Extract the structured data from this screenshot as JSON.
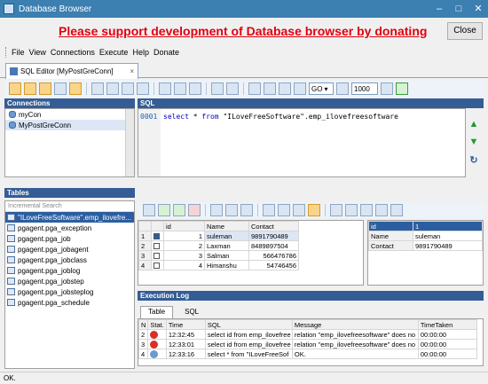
{
  "window": {
    "title": "Database Browser"
  },
  "banner": {
    "text": "Please support development of Database browser by donating",
    "color": "#e1000f"
  },
  "close_button": {
    "label": "Close"
  },
  "menu": [
    "File",
    "View",
    "Connections",
    "Execute",
    "Help",
    "Donate"
  ],
  "editor_tab": {
    "label": "SQL Editor [MyPostGreConn]"
  },
  "toolbar": {
    "go_label": "GO",
    "limit_value": "1000"
  },
  "connections": {
    "header": "Connections",
    "items": [
      {
        "label": "myCon"
      },
      {
        "label": "MyPostGreConn"
      }
    ]
  },
  "sql": {
    "header": "SQL",
    "line_no": "0001",
    "code_kw1": "select",
    "code_mid": " * ",
    "code_kw2": "from",
    "code_rest": " \"ILoveFreeSoftware\".emp_ilovefreesoftware"
  },
  "tables": {
    "header": "Tables",
    "search_placeholder": "Incremental Search",
    "items": [
      "\"ILoveFreeSoftware\".emp_ilovefre...",
      "pgagent.pga_exception",
      "pgagent.pga_job",
      "pgagent.pga_jobagent",
      "pgagent.pga_jobclass",
      "pgagent.pga_joblog",
      "pgagent.pga_jobstep",
      "pgagent.pga_jobsteplog",
      "pgagent.pga_schedule"
    ]
  },
  "grid": {
    "columns": [
      "id",
      "Name",
      "Contact"
    ],
    "rows": [
      {
        "n": "1",
        "id": "1",
        "name": "suleman",
        "contact": "9891790489"
      },
      {
        "n": "2",
        "id": "2",
        "name": "Laxman",
        "contact": "8489897504"
      },
      {
        "n": "3",
        "id": "3",
        "name": "Salman",
        "contact": "566476786"
      },
      {
        "n": "4",
        "id": "4",
        "name": "Himanshu",
        "contact": "54746456"
      }
    ]
  },
  "record": [
    {
      "k": "id",
      "v": "1"
    },
    {
      "k": "Name",
      "v": "suleman"
    },
    {
      "k": "Contact",
      "v": "9891790489"
    }
  ],
  "execution_log": {
    "header": "Execution Log",
    "tabs": [
      "Table",
      "SQL"
    ],
    "columns": [
      "N",
      "Stat.",
      "Time",
      "SQL",
      "Message",
      "TimeTaken"
    ],
    "rows": [
      {
        "n": "2",
        "status": "error",
        "time": "12:32:45",
        "sql": "select id from emp_ilovefree",
        "message": "relation \"emp_ilovefreesoftware\" does no",
        "taken": "00:00:00"
      },
      {
        "n": "3",
        "status": "error",
        "time": "12:33:01",
        "sql": "select id from emp_ilovefree",
        "message": "relation \"emp_ilovefreesoftware\" does no",
        "taken": "00:00:00"
      },
      {
        "n": "4",
        "status": "ok",
        "time": "12:33:16",
        "sql": "select * from \"ILoveFreeSof",
        "message": "OK.",
        "taken": "00:00:00"
      }
    ]
  },
  "status_bar": {
    "text": "OK."
  },
  "colors": {
    "panel_header": "#345d96",
    "selection": "#2b5ea0",
    "error": "#d93025",
    "ok": "#6a9ad0"
  }
}
